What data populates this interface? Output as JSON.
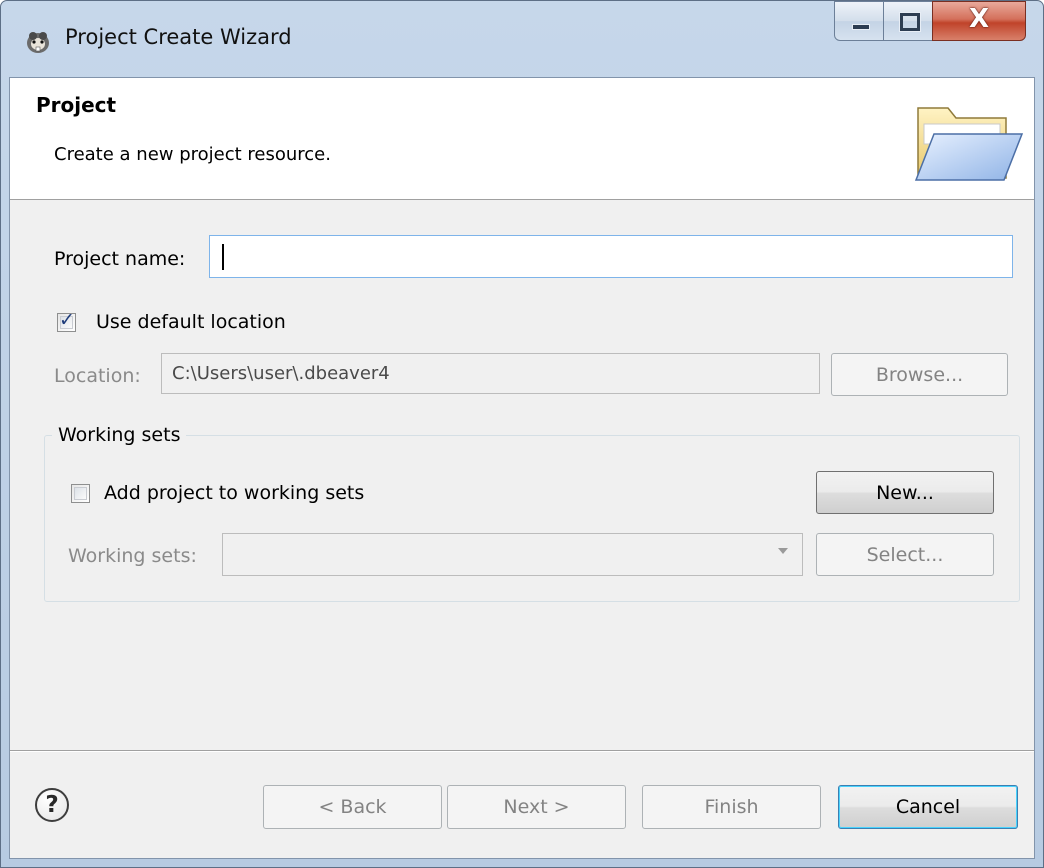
{
  "window": {
    "title": "Project Create Wizard",
    "close_glyph": "X"
  },
  "banner": {
    "title": "Project",
    "description": "Create a new project resource.",
    "icon": "folder-icon"
  },
  "form": {
    "project_name_label": "Project name:",
    "project_name_value": "",
    "use_default_location_label": "Use default location",
    "use_default_location_checked": true,
    "location_label": "Location:",
    "location_value": "C:\\Users\\user\\.dbeaver4",
    "browse_label": "Browse..."
  },
  "working_sets": {
    "group_title": "Working sets",
    "add_label": "Add project to working sets",
    "add_checked": false,
    "new_label": "New...",
    "sets_label": "Working sets:",
    "sets_value": "",
    "select_label": "Select..."
  },
  "footer": {
    "help_glyph": "?",
    "back_label": "< Back",
    "next_label": "Next >",
    "finish_label": "Finish",
    "cancel_label": "Cancel"
  },
  "colors": {
    "title_bar": "#c6d7ea",
    "dialog_bg": "#f0f0f0",
    "close_button": "#c0432a",
    "focus_border": "#7eb4ea"
  }
}
